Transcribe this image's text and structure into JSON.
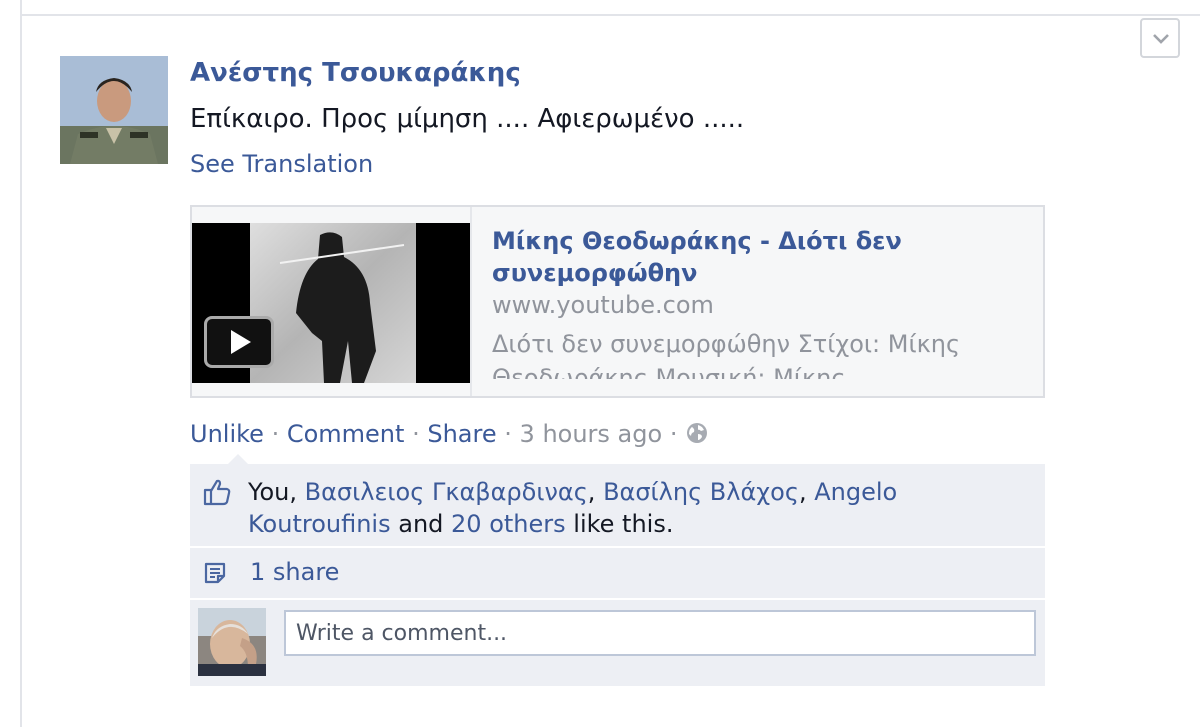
{
  "post": {
    "author": "Ανέστης Τσουκαράκης",
    "text": "Επίκαιρο. Προς μίμηση .... Αφιερωμένο .....",
    "see_translation": "See Translation"
  },
  "link_card": {
    "title": "Μίκης Θεοδωράκης - Διότι δεν συνεμορφώθην",
    "domain": "www.youtube.com",
    "description": "Διότι δεν συνεμορφώθην Στίχοι: Μίκης Θεοδωράκης Μουσική: Μίκης"
  },
  "actions": {
    "unlike": "Unlike",
    "comment": "Comment",
    "share": "Share",
    "time": "3 hours ago",
    "separator": "·"
  },
  "likes": {
    "you": "You,",
    "person1": "Βασιλειος Γκαβαρδινας",
    "person2": "Βασίλης Βλάχος",
    "person3": "Angelo Koutroufinis",
    "comma": ",",
    "and": "and",
    "others": "20 others",
    "suffix": "like this."
  },
  "shares": {
    "label": "1 share"
  },
  "comment_box": {
    "placeholder": "Write a comment..."
  },
  "colors": {
    "link": "#3b5998",
    "muted": "#90949c",
    "ufi_bg": "#edeff4"
  },
  "icons": {
    "menu": "chevron-down-icon",
    "play": "play-icon",
    "audience": "globe-icon",
    "like": "thumbs-up-icon",
    "share": "share-icon"
  }
}
